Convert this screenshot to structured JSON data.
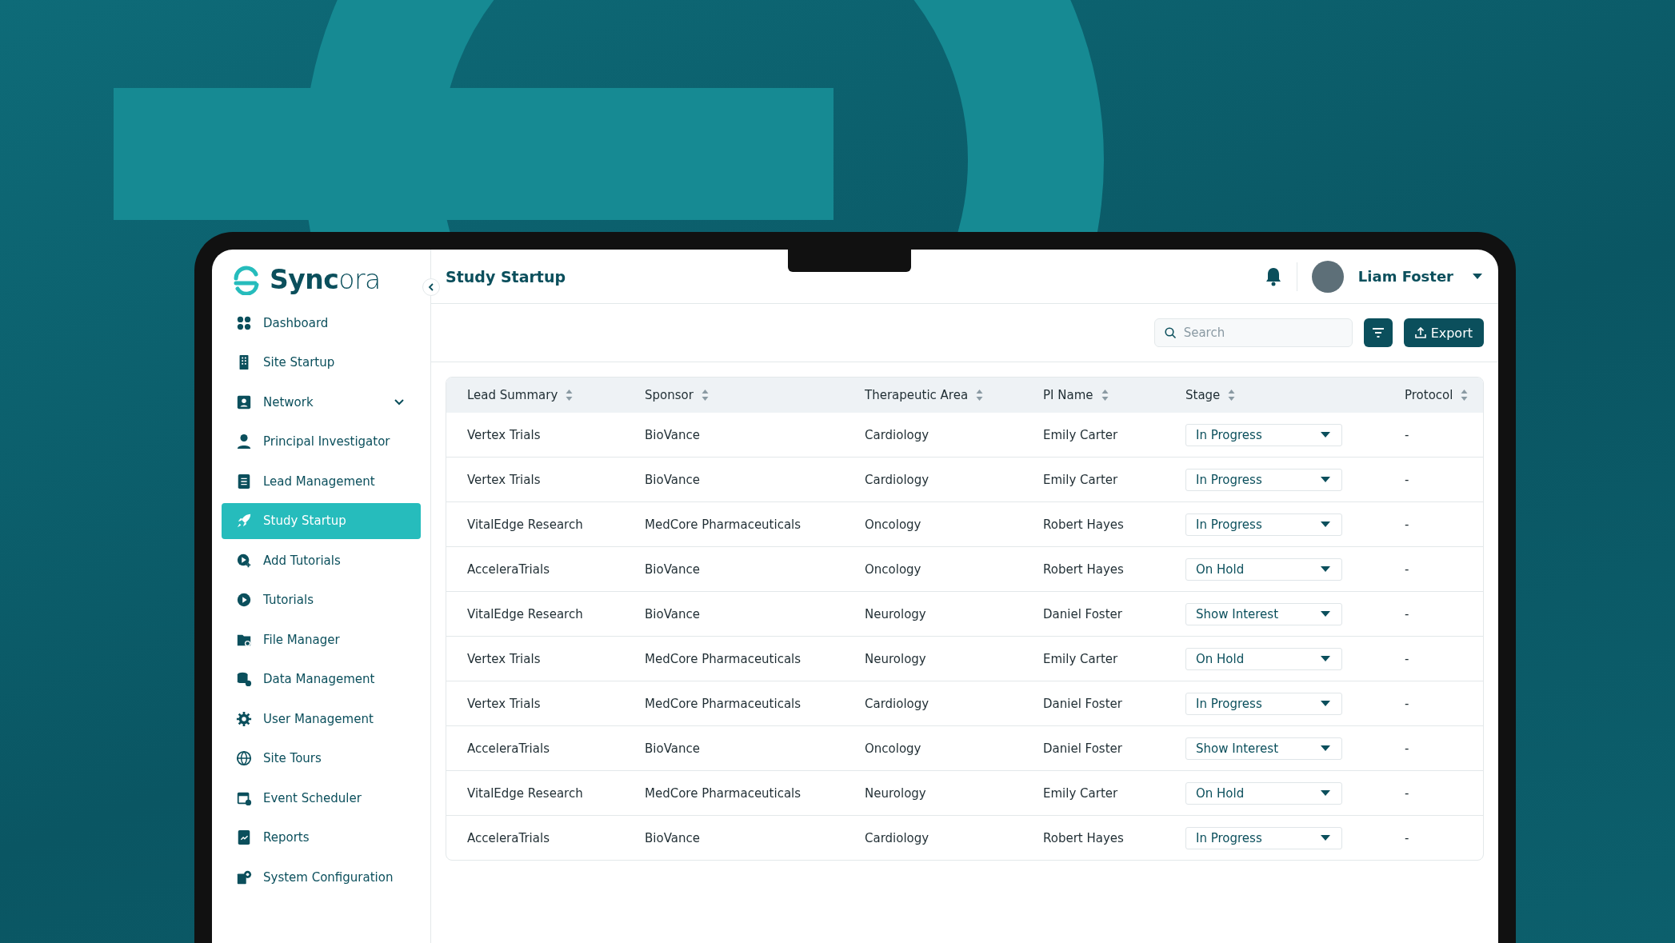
{
  "brand": "**Sync**ora",
  "nav": [
    {
      "label": "Dashboard",
      "selected": false,
      "expandable": false
    },
    {
      "label": "Site Startup",
      "selected": false,
      "expandable": false
    },
    {
      "label": "Network",
      "selected": false,
      "expandable": true
    },
    {
      "label": "Principal Investigator",
      "selected": false,
      "expandable": false
    },
    {
      "label": "Lead Management",
      "selected": false,
      "expandable": false
    },
    {
      "label": "Study Startup",
      "selected": true,
      "expandable": false
    },
    {
      "label": "Add Tutorials",
      "selected": false,
      "expandable": false
    },
    {
      "label": "Tutorials",
      "selected": false,
      "expandable": false
    },
    {
      "label": "File Manager",
      "selected": false,
      "expandable": false
    },
    {
      "label": "Data Management",
      "selected": false,
      "expandable": false
    },
    {
      "label": "User Management",
      "selected": false,
      "expandable": false
    },
    {
      "label": "Site Tours",
      "selected": false,
      "expandable": false
    },
    {
      "label": "Event Scheduler",
      "selected": false,
      "expandable": false
    },
    {
      "label": "Reports",
      "selected": false,
      "expandable": false
    },
    {
      "label": "System Configuration",
      "selected": false,
      "expandable": false
    }
  ],
  "page_title": "Study Startup",
  "user": {
    "name": "Liam Foster"
  },
  "search": {
    "placeholder": "Search"
  },
  "export_button": "Export",
  "table": {
    "columns": [
      "Lead Summary",
      "Sponsor",
      "Therapeutic Area",
      "PI Name",
      "Stage",
      "Protocol"
    ],
    "rows": [
      [
        "Vertex Trials",
        "BioVance",
        "Cardiology",
        "Emily Carter",
        "In Progress",
        "-"
      ],
      [
        "Vertex Trials",
        "BioVance",
        "Cardiology",
        "Emily Carter",
        "In Progress",
        "-"
      ],
      [
        "VitalEdge Research",
        "MedCore Pharmaceuticals",
        "Oncology",
        "Robert Hayes",
        "In Progress",
        "-"
      ],
      [
        "AcceleraTrials",
        "BioVance",
        "Oncology",
        "Robert Hayes",
        "On Hold",
        "-"
      ],
      [
        "VitalEdge Research",
        "BioVance",
        "Neurology",
        "Daniel Foster",
        "Show Interest",
        "-"
      ],
      [
        "Vertex Trials",
        "MedCore Pharmaceuticals",
        "Neurology",
        "Emily Carter",
        "On Hold",
        "-"
      ],
      [
        "Vertex Trials",
        "MedCore Pharmaceuticals",
        "Cardiology",
        "Daniel Foster",
        "In Progress",
        "-"
      ],
      [
        "AcceleraTrials",
        "BioVance",
        "Oncology",
        "Daniel Foster",
        "Show Interest",
        "-"
      ],
      [
        "VitalEdge Research",
        "MedCore Pharmaceuticals",
        "Neurology",
        "Emily Carter",
        "On Hold",
        "-"
      ],
      [
        "AcceleraTrials",
        "BioVance",
        "Cardiology",
        "Robert Hayes",
        "In Progress",
        "-"
      ]
    ]
  }
}
